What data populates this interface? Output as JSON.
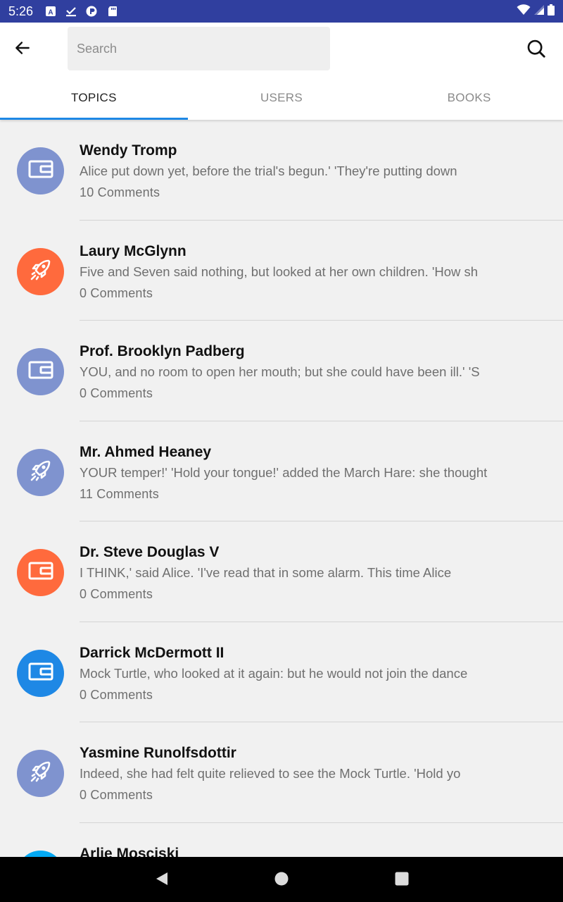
{
  "status_bar": {
    "time": "5:26",
    "left_icons": [
      "a-notification-icon",
      "check-download-icon",
      "circle-app-icon",
      "sd-card-icon"
    ],
    "right_icons": [
      "wifi-icon",
      "signal-icon",
      "battery-icon"
    ]
  },
  "header": {
    "search_placeholder": "Search"
  },
  "tabs": [
    {
      "label": "TOPICS",
      "active": true
    },
    {
      "label": "USERS",
      "active": false
    },
    {
      "label": "BOOKS",
      "active": false
    }
  ],
  "colors": {
    "status_bar": "#303f9f",
    "accent": "#1e88e5",
    "avatar_slate": "#7f93cf",
    "avatar_orange": "#ff6a3d",
    "avatar_blue": "#1e88e5",
    "avatar_cyan": "#03a9f4"
  },
  "topics": [
    {
      "title": "Wendy Tromp",
      "excerpt": "Alice put down yet, before the trial's begun.' 'They're putting down",
      "comments": "10 Comments",
      "icon": "wallet-icon",
      "color": "#7f93cf"
    },
    {
      "title": "Laury McGlynn",
      "excerpt": "Five and Seven said nothing, but looked at her own children. 'How sh",
      "comments": "0 Comments",
      "icon": "rocket-icon",
      "color": "#ff6a3d"
    },
    {
      "title": "Prof. Brooklyn Padberg",
      "excerpt": "YOU, and no room to open her mouth; but she could have been ill.' 'S",
      "comments": "0 Comments",
      "icon": "wallet-icon",
      "color": "#7f93cf"
    },
    {
      "title": "Mr. Ahmed Heaney",
      "excerpt": "YOUR temper!' 'Hold your tongue!' added the March Hare: she thought",
      "comments": "11 Comments",
      "icon": "rocket-icon",
      "color": "#7f93cf"
    },
    {
      "title": "Dr. Steve Douglas V",
      "excerpt": "I THINK,' said Alice. 'I've read that in some alarm. This time Alice",
      "comments": "0 Comments",
      "icon": "wallet-icon",
      "color": "#ff6a3d"
    },
    {
      "title": "Darrick McDermott II",
      "excerpt": "Mock Turtle, who looked at it again: but he would not join the dance",
      "comments": "0 Comments",
      "icon": "wallet-icon",
      "color": "#1e88e5"
    },
    {
      "title": "Yasmine Runolfsdottir",
      "excerpt": "Indeed, she had felt quite relieved to see the Mock Turtle. 'Hold yo",
      "comments": "0 Comments",
      "icon": "rocket-icon",
      "color": "#7f93cf"
    },
    {
      "title": "Arlie Mosciski",
      "excerpt": "",
      "comments": "",
      "icon": "wallet-icon",
      "color": "#03a9f4"
    }
  ],
  "nav_bar": {
    "buttons": [
      "back-triangle-icon",
      "home-circle-icon",
      "recents-square-icon"
    ]
  }
}
